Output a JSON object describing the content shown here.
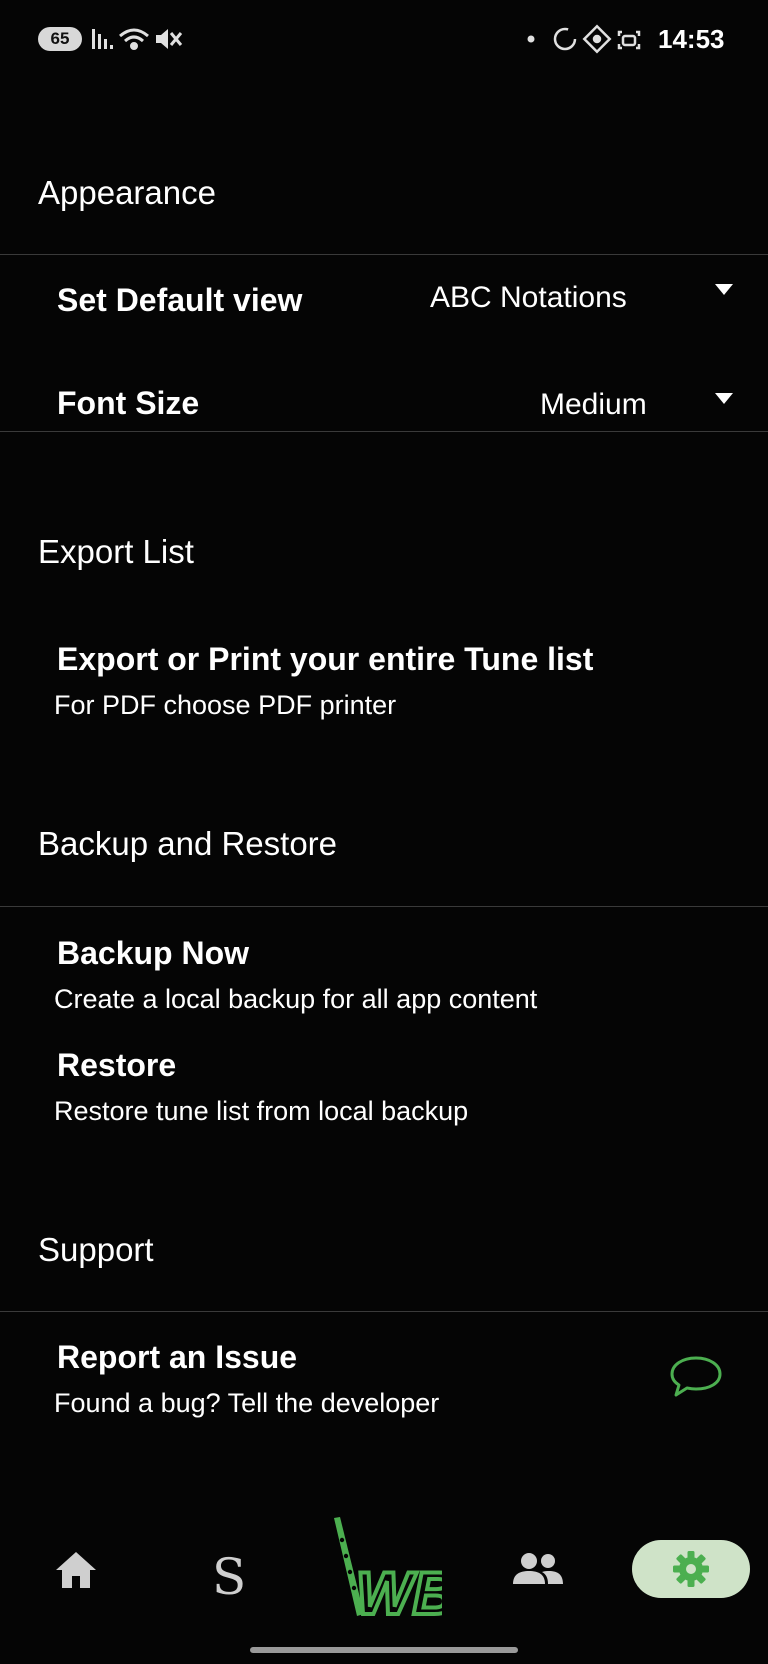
{
  "status_bar": {
    "battery": "65",
    "time": "14:53"
  },
  "sections": {
    "appearance": {
      "header": "Appearance",
      "default_view_label": "Set Default view",
      "default_view_value": "ABC Notations",
      "font_size_label": "Font Size",
      "font_size_value": "Medium"
    },
    "export": {
      "header": "Export List",
      "title": "Export or Print your entire Tune list",
      "subtitle": "For PDF choose PDF printer"
    },
    "backup": {
      "header": "Backup and Restore",
      "backup_title": "Backup Now",
      "backup_subtitle": "Create a local backup for all app content",
      "restore_title": "Restore",
      "restore_subtitle": "Restore tune list from local backup"
    },
    "support": {
      "header": "Support",
      "report_title": "Report an Issue",
      "report_subtitle": "Found a bug? Tell the developer"
    }
  },
  "bottom_nav": {
    "s_label": "S",
    "wb_label": "WB",
    "active_tab": "settings"
  },
  "colors": {
    "background": "#050505",
    "accent_green": "#4caf50",
    "active_pill": "#cfe3c8",
    "divider": "#3a3a3a"
  },
  "icons": {
    "report": "chat-bubble-icon",
    "home": "home-icon",
    "people": "people-icon",
    "settings": "gear-icon",
    "dropdown": "caret-down-icon"
  }
}
